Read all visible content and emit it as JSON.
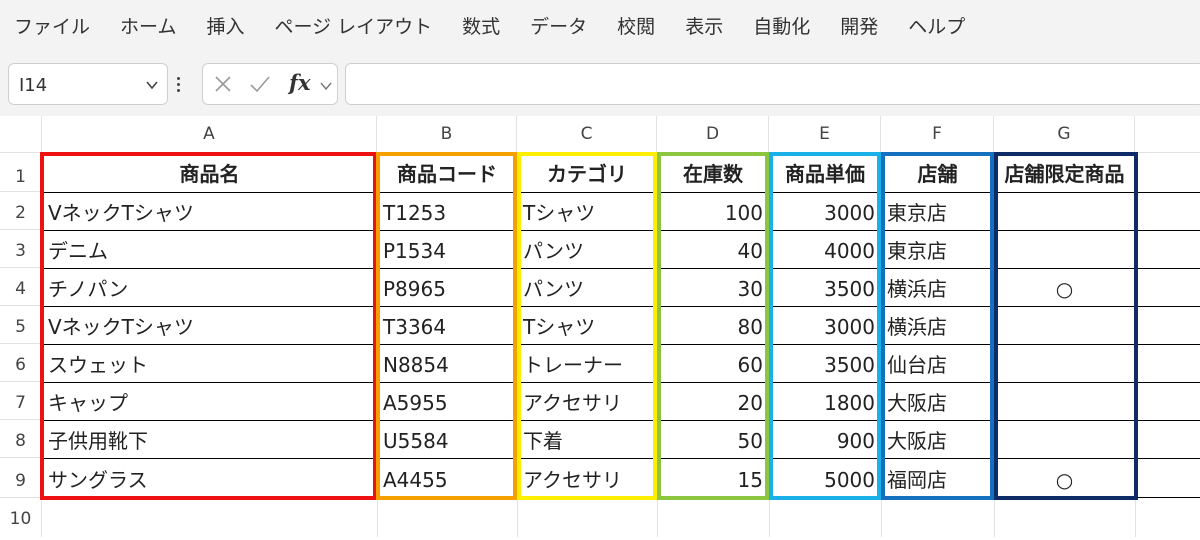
{
  "menu": [
    "ファイル",
    "ホーム",
    "挿入",
    "ページ レイアウト",
    "数式",
    "データ",
    "校閲",
    "表示",
    "自動化",
    "開発",
    "ヘルプ"
  ],
  "formula_bar": {
    "name_box": "I14",
    "fx": "fx",
    "formula": ""
  },
  "columns": [
    "A",
    "B",
    "C",
    "D",
    "E",
    "F",
    "G"
  ],
  "rows": [
    "1",
    "2",
    "3",
    "4",
    "5",
    "6",
    "7",
    "8",
    "9",
    "10"
  ],
  "table": {
    "headers": [
      "商品名",
      "商品コード",
      "カテゴリ",
      "在庫数",
      "商品単価",
      "店舗",
      "店舗限定商品"
    ],
    "rows": [
      [
        "VネックTシャツ",
        "T1253",
        "Tシャツ",
        "100",
        "3000",
        "東京店",
        ""
      ],
      [
        "デニム",
        "P1534",
        "パンツ",
        "40",
        "4000",
        "東京店",
        ""
      ],
      [
        "チノパン",
        "P8965",
        "パンツ",
        "30",
        "3500",
        "横浜店",
        "○"
      ],
      [
        "VネックTシャツ",
        "T3364",
        "Tシャツ",
        "80",
        "3000",
        "横浜店",
        ""
      ],
      [
        "スウェット",
        "N8854",
        "トレーナー",
        "60",
        "3500",
        "仙台店",
        ""
      ],
      [
        "キャップ",
        "A5955",
        "アクセサリ",
        "20",
        "1800",
        "大阪店",
        ""
      ],
      [
        "子供用靴下",
        "U5584",
        "下着",
        "50",
        "900",
        "大阪店",
        ""
      ],
      [
        "サングラス",
        "A4455",
        "アクセサリ",
        "15",
        "5000",
        "福岡店",
        "○"
      ]
    ]
  },
  "colors": {
    "col_A": "#ee1111",
    "col_B": "#f5a000",
    "col_C": "#ffee00",
    "col_D": "#8cc63f",
    "col_E": "#1ab0e8",
    "col_F": "#1670c0",
    "col_G": "#0d2b66"
  },
  "icons": {
    "cancel": "cancel-x-icon",
    "enter": "checkmark-icon",
    "dropdown": "chevron-down-icon",
    "more": "vertical-dots-icon"
  }
}
